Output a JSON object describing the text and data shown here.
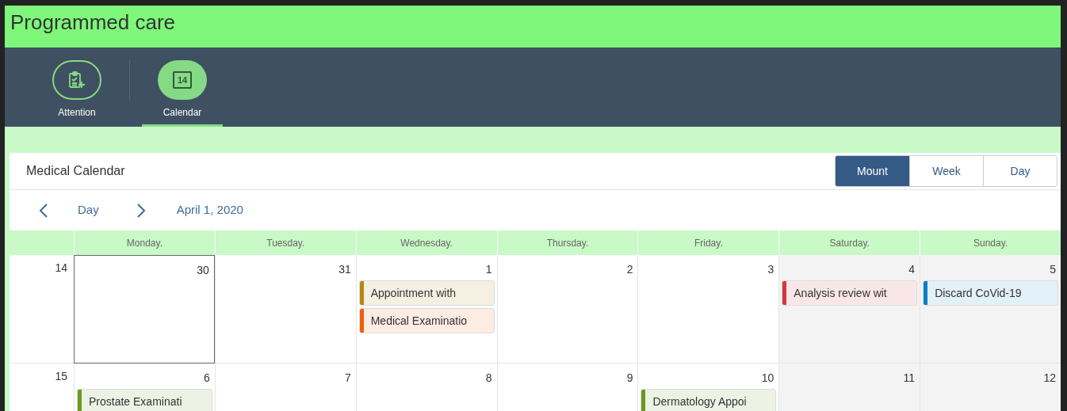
{
  "title": "Programmed care",
  "tabs": [
    {
      "label": "Attention",
      "selected": false
    },
    {
      "label": "Calendar",
      "selected": true
    }
  ],
  "calendar_icon_day": "14",
  "card": {
    "title": "Medical Calendar",
    "views": [
      {
        "label": "Mount",
        "selected": true
      },
      {
        "label": "Week",
        "selected": false
      },
      {
        "label": "Day",
        "selected": false
      }
    ],
    "nav": {
      "mode": "Day",
      "date": "April 1, 2020"
    },
    "weekdays": [
      {
        "label": "Monday.",
        "weekend": false
      },
      {
        "label": "Tuesday.",
        "weekend": false
      },
      {
        "label": "Wednesday.",
        "weekend": false
      },
      {
        "label": "Thursday.",
        "weekend": false
      },
      {
        "label": "Friday.",
        "weekend": false
      },
      {
        "label": "Saturday.",
        "weekend": true
      },
      {
        "label": "Sunday.",
        "weekend": true
      }
    ],
    "weeks": [
      {
        "number": "14",
        "days": [
          {
            "day": "30",
            "selected": true
          },
          {
            "day": "31",
            "selected": false
          },
          {
            "day": "1",
            "selected": false,
            "events": [
              {
                "title": "Appointment with",
                "color": "#b8860b"
              },
              {
                "title": "Medical Examinatio",
                "color": "#e8620c"
              }
            ]
          },
          {
            "day": "2",
            "selected": false
          },
          {
            "day": "3",
            "selected": false
          },
          {
            "day": "4",
            "selected": false,
            "events": [
              {
                "title": "Analysis review wit",
                "color": "#d0393b"
              }
            ]
          },
          {
            "day": "5",
            "selected": false,
            "events": [
              {
                "title": "Discard CoVid-19",
                "color": "#0a7fc6"
              }
            ]
          }
        ]
      },
      {
        "number": "15",
        "days": [
          {
            "day": "6",
            "selected": false,
            "events": [
              {
                "title": "Prostate Examinati",
                "color": "#6a9a1f"
              }
            ]
          },
          {
            "day": "7",
            "selected": false
          },
          {
            "day": "8",
            "selected": false
          },
          {
            "day": "9",
            "selected": false
          },
          {
            "day": "10",
            "selected": false,
            "events": [
              {
                "title": "Dermatology Appoi",
                "color": "#6a9a1f"
              }
            ]
          },
          {
            "day": "11",
            "selected": false
          },
          {
            "day": "12",
            "selected": false
          }
        ]
      }
    ]
  }
}
